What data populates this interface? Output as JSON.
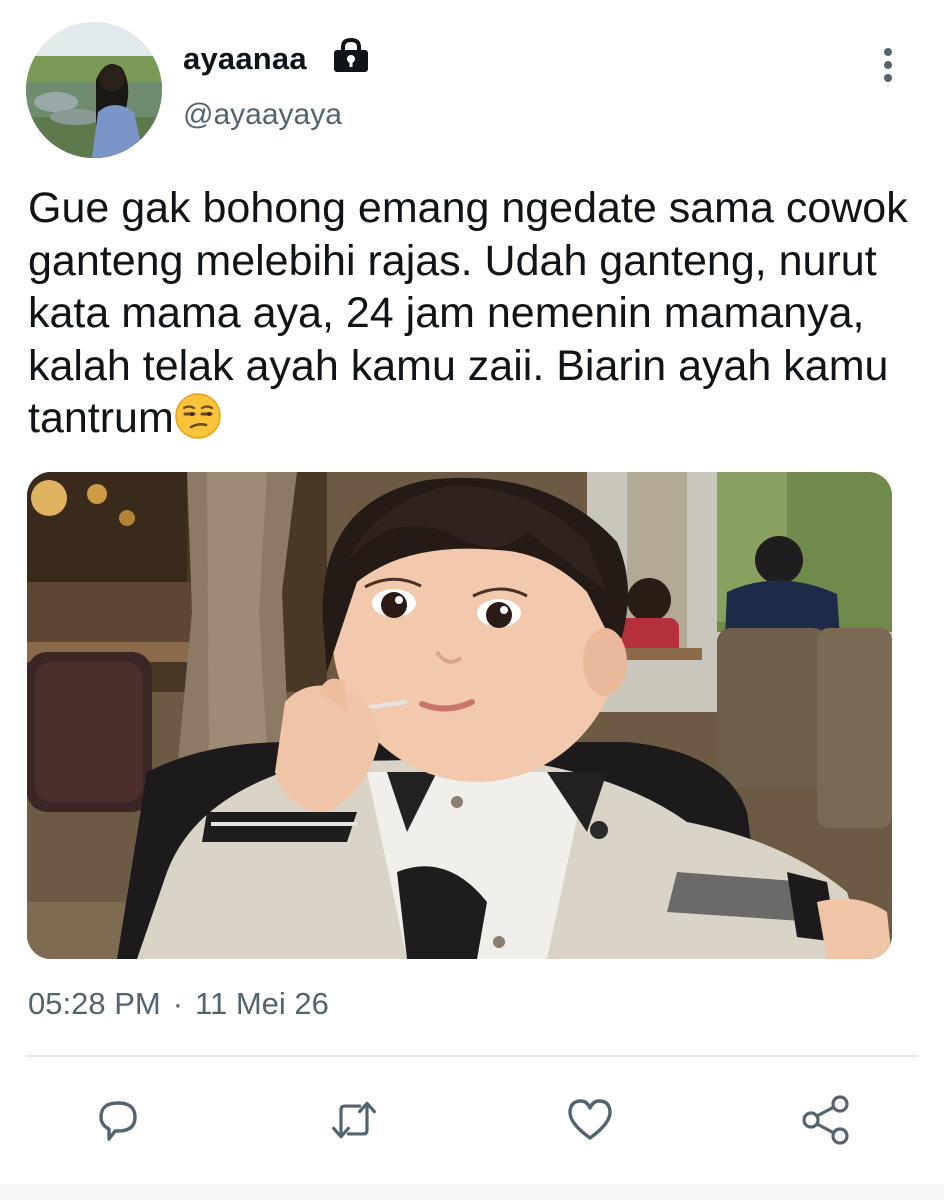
{
  "author": {
    "display_name": "ayaanaa",
    "handle": "@ayaayaya",
    "protected_icon": "lock-icon",
    "avatar": "profile-photo"
  },
  "tweet": {
    "text": "Gue gak bohong emang ngedate sama cowok ganteng melebihi rajas. Udah ganteng, nurut kata mama aya, 24 jam nemenin mamanya, kalah telak ayah kamu zaii. Biarin ayah kamu tantrum",
    "emoji": "unamused-face-emoji",
    "time": "05:28 PM",
    "separator": "·",
    "date": "11 Mei 26"
  },
  "media": {
    "type": "photo"
  },
  "actions": [
    {
      "name": "reply",
      "icon": "reply-icon"
    },
    {
      "name": "retweet",
      "icon": "retweet-icon"
    },
    {
      "name": "like",
      "icon": "heart-icon"
    },
    {
      "name": "share",
      "icon": "share-icon"
    }
  ],
  "colors": {
    "text": "#0f1419",
    "secondary": "#536471",
    "divider": "#e4e8eb"
  }
}
